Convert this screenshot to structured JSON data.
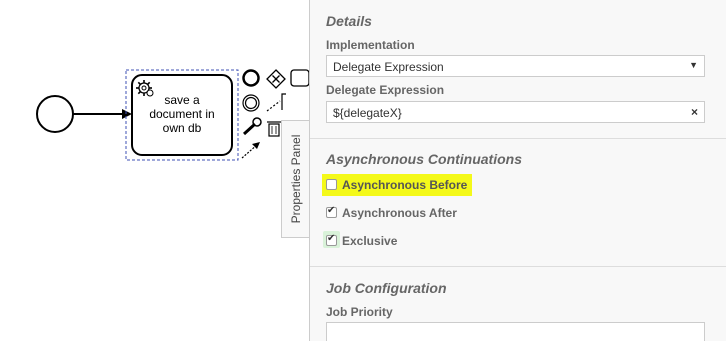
{
  "task": {
    "label_line1": "save a",
    "label_line2": "document in",
    "label_line3": "own db",
    "icon": "gear-icon"
  },
  "panel_tab": {
    "label": "Properties Panel"
  },
  "details": {
    "title": "Details",
    "implementation_label": "Implementation",
    "implementation_value": "Delegate Expression",
    "delegate_expression_label": "Delegate Expression",
    "delegate_expression_value": "${delegateX}"
  },
  "async": {
    "title": "Asynchronous Continuations",
    "before_label": "Asynchronous Before",
    "before_checked": false,
    "before_highlight_color": "#f4f91a",
    "after_label": "Asynchronous After",
    "after_checked": true,
    "exclusive_label": "Exclusive",
    "exclusive_checked": true
  },
  "job": {
    "title": "Job Configuration",
    "priority_label": "Job Priority",
    "priority_value": ""
  },
  "colors": {
    "panel_bg": "#f8f8f8",
    "selection": "#3f51b5"
  }
}
